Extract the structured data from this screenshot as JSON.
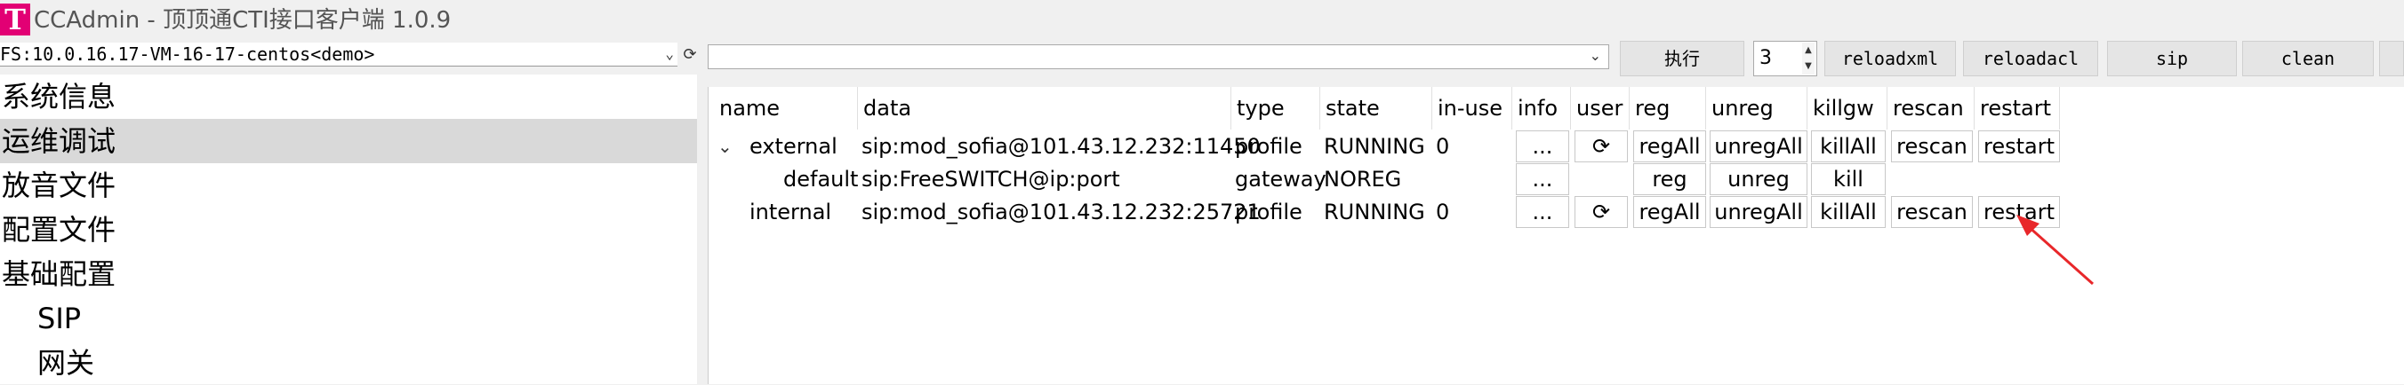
{
  "window": {
    "logo_letter": "T",
    "title": "CCAdmin - 顶顶通CTI接口客户端 1.0.9"
  },
  "toolbar": {
    "fs_server": "FS:10.0.16.17-VM-16-17-centos<demo>",
    "command": "",
    "execute_label": "执行",
    "count_value": "3",
    "buttons": [
      "reloadxml",
      "reloadacl",
      "sip",
      "clean"
    ]
  },
  "sidebar": {
    "items": [
      {
        "label": "系统信息"
      },
      {
        "label": "运维调试"
      },
      {
        "label": "放音文件"
      },
      {
        "label": "配置文件"
      },
      {
        "label": "基础配置"
      },
      {
        "label": "SIP"
      },
      {
        "label": "网关"
      }
    ],
    "selected_index": 1
  },
  "table": {
    "columns": [
      "name",
      "data",
      "type",
      "state",
      "in-use",
      "info",
      "user",
      "reg",
      "unreg",
      "killgw",
      "rescan",
      "restart"
    ],
    "rows": [
      {
        "name": "external",
        "data": "sip:mod_sofia@101.43.12.232:11450",
        "type": "profile",
        "state": "RUNNING",
        "in_use": "0",
        "info": "...",
        "user": "⟳",
        "reg": "regAll",
        "unreg": "unregAll",
        "killgw": "killAll",
        "rescan": "rescan",
        "restart": "restart"
      },
      {
        "name": "default",
        "data": "sip:FreeSWITCH@ip:port",
        "type": "gateway",
        "state": "NOREG",
        "in_use": "",
        "info": "...",
        "reg": "reg",
        "unreg": "unreg",
        "killgw": "kill"
      },
      {
        "name": "internal",
        "data": "sip:mod_sofia@101.43.12.232:25721",
        "type": "profile",
        "state": "RUNNING",
        "in_use": "0",
        "info": "...",
        "user": "⟳",
        "reg": "regAll",
        "unreg": "unregAll",
        "killgw": "killAll",
        "rescan": "rescan",
        "restart": "restart"
      }
    ]
  },
  "colors": {
    "logo": "#e20074",
    "annotation_arrow": "#e8272a",
    "selected_row": "#d9d9d9"
  }
}
